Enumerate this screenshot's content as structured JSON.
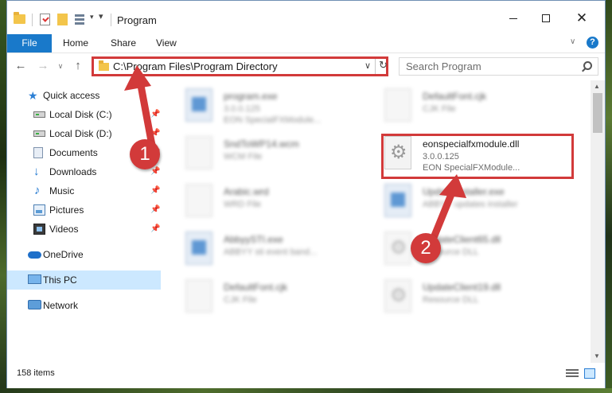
{
  "window": {
    "title": "Program",
    "controls": {
      "minimize": "—",
      "maximize": "□",
      "close": "✕"
    }
  },
  "ribbon": {
    "tabs": [
      "File",
      "Home",
      "Share",
      "View"
    ],
    "help": "?"
  },
  "navbar": {
    "address": "C:\\Program Files\\Program Directory",
    "search_placeholder": "Search Program"
  },
  "sidebar": {
    "items": [
      {
        "label": "Quick access",
        "icon": "star-icon",
        "pinned": false
      },
      {
        "label": "Local Disk (C:)",
        "icon": "disk-icon",
        "pinned": true
      },
      {
        "label": "Local Disk (D:)",
        "icon": "disk-icon",
        "pinned": true
      },
      {
        "label": "Documents",
        "icon": "documents-icon",
        "pinned": true
      },
      {
        "label": "Downloads",
        "icon": "download-icon",
        "pinned": true
      },
      {
        "label": "Music",
        "icon": "music-icon",
        "pinned": true
      },
      {
        "label": "Pictures",
        "icon": "pictures-icon",
        "pinned": true
      },
      {
        "label": "Videos",
        "icon": "videos-icon",
        "pinned": true
      },
      {
        "label": "OneDrive",
        "icon": "cloud-icon",
        "pinned": false
      },
      {
        "label": "This PC",
        "icon": "computer-icon",
        "pinned": false,
        "selected": true
      },
      {
        "label": "Network",
        "icon": "network-icon",
        "pinned": false
      }
    ]
  },
  "files": [
    {
      "name": "program.exe",
      "line1": "3.0.0.125",
      "line2": "EON SpecialFXModule...",
      "blurred": true
    },
    {
      "name": "DefaultFont.cjk",
      "line1": "CJK File",
      "line2": "",
      "blurred": true
    },
    {
      "name": "SndToWP14.wcm",
      "line1": "WCM File",
      "line2": "",
      "blurred": true
    },
    {
      "name": "eonspecialfxmodule.dll",
      "line1": "3.0.0.125",
      "line2": "EON SpecialFXModule...",
      "blurred": false,
      "highlighted": true
    },
    {
      "name": "Arabic.wrd",
      "line1": "WRD File",
      "line2": "",
      "blurred": true
    },
    {
      "name": "UpdateInstaller.exe",
      "line1": "ABBYY updates installer",
      "line2": "",
      "blurred": true
    },
    {
      "name": "AbbyySTI.exe",
      "line1": "ABBYY sti event band...",
      "line2": "",
      "blurred": true
    },
    {
      "name": "UpdateClient65.dll",
      "line1": "Resource DLL",
      "line2": "",
      "blurred": true
    },
    {
      "name": "DefaultFont.cjk",
      "line1": "CJK File",
      "line2": "",
      "blurred": true
    },
    {
      "name": "UpdateClient19.dll",
      "line1": "Resource DLL",
      "line2": "",
      "blurred": true
    }
  ],
  "status": {
    "item_count": "158 items"
  },
  "annotations": {
    "step1": "1",
    "step2": "2",
    "color": "#d23a3a"
  }
}
